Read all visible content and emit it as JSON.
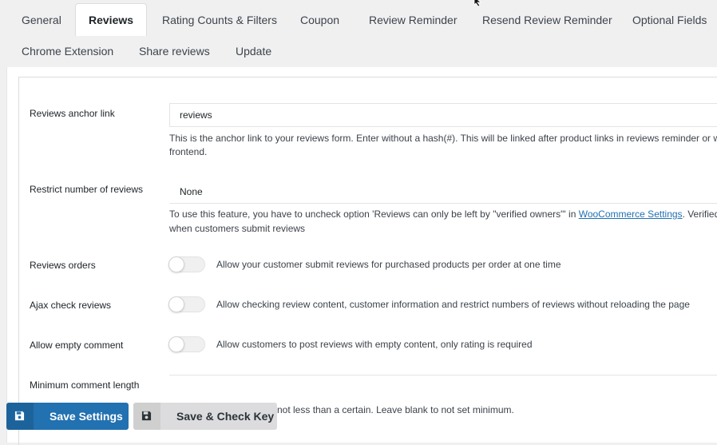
{
  "tabs": [
    {
      "label": "General"
    },
    {
      "label": "Reviews"
    },
    {
      "label": "Rating Counts & Filters"
    },
    {
      "label": "Coupon"
    },
    {
      "label": "Review Reminder"
    },
    {
      "label": "Resend Review Reminder"
    },
    {
      "label": "Optional Fields"
    },
    {
      "label": "Chrome Extension"
    },
    {
      "label": "Share reviews"
    },
    {
      "label": "Update"
    }
  ],
  "active_tab": "Reviews",
  "settings": {
    "anchor_link": {
      "label": "Reviews anchor link",
      "value": "reviews",
      "desc_line1": "This is the anchor link to your reviews form. Enter without a hash(#). This will be linked after product links in reviews reminder or when",
      "desc_line2": "frontend."
    },
    "restrict": {
      "label": "Restrict number of reviews",
      "value": "None",
      "desc_pre": "To use this feature, you have to uncheck option 'Reviews can only be left by \"verified owners\"' in ",
      "desc_link": "WooCommerce Settings",
      "desc_post": ". Verified own",
      "desc_line2": "when customers submit reviews"
    },
    "reviews_orders": {
      "label": "Reviews orders",
      "enabled": false,
      "desc": "Allow your customer submit reviews for purchased products per order at one time"
    },
    "ajax_check": {
      "label": "Ajax check reviews",
      "enabled": false,
      "desc": "Allow checking review content, customer information and restrict numbers of reviews without reloading the page"
    },
    "empty_comment": {
      "label": "Allow empty comment",
      "enabled": false,
      "desc": "Allow customers to post reviews with empty content, only rating is required"
    },
    "min_length": {
      "label": "Minimum comment length",
      "value": "",
      "desc_partial": "not less than a certain. Leave blank to not set minimum."
    }
  },
  "buttons": {
    "save": "Save Settings",
    "check": "Save & Check Key"
  },
  "colors": {
    "primary": "#2271b1",
    "secondary_btn": "#dcdcde",
    "background": "#f0f0f1"
  }
}
